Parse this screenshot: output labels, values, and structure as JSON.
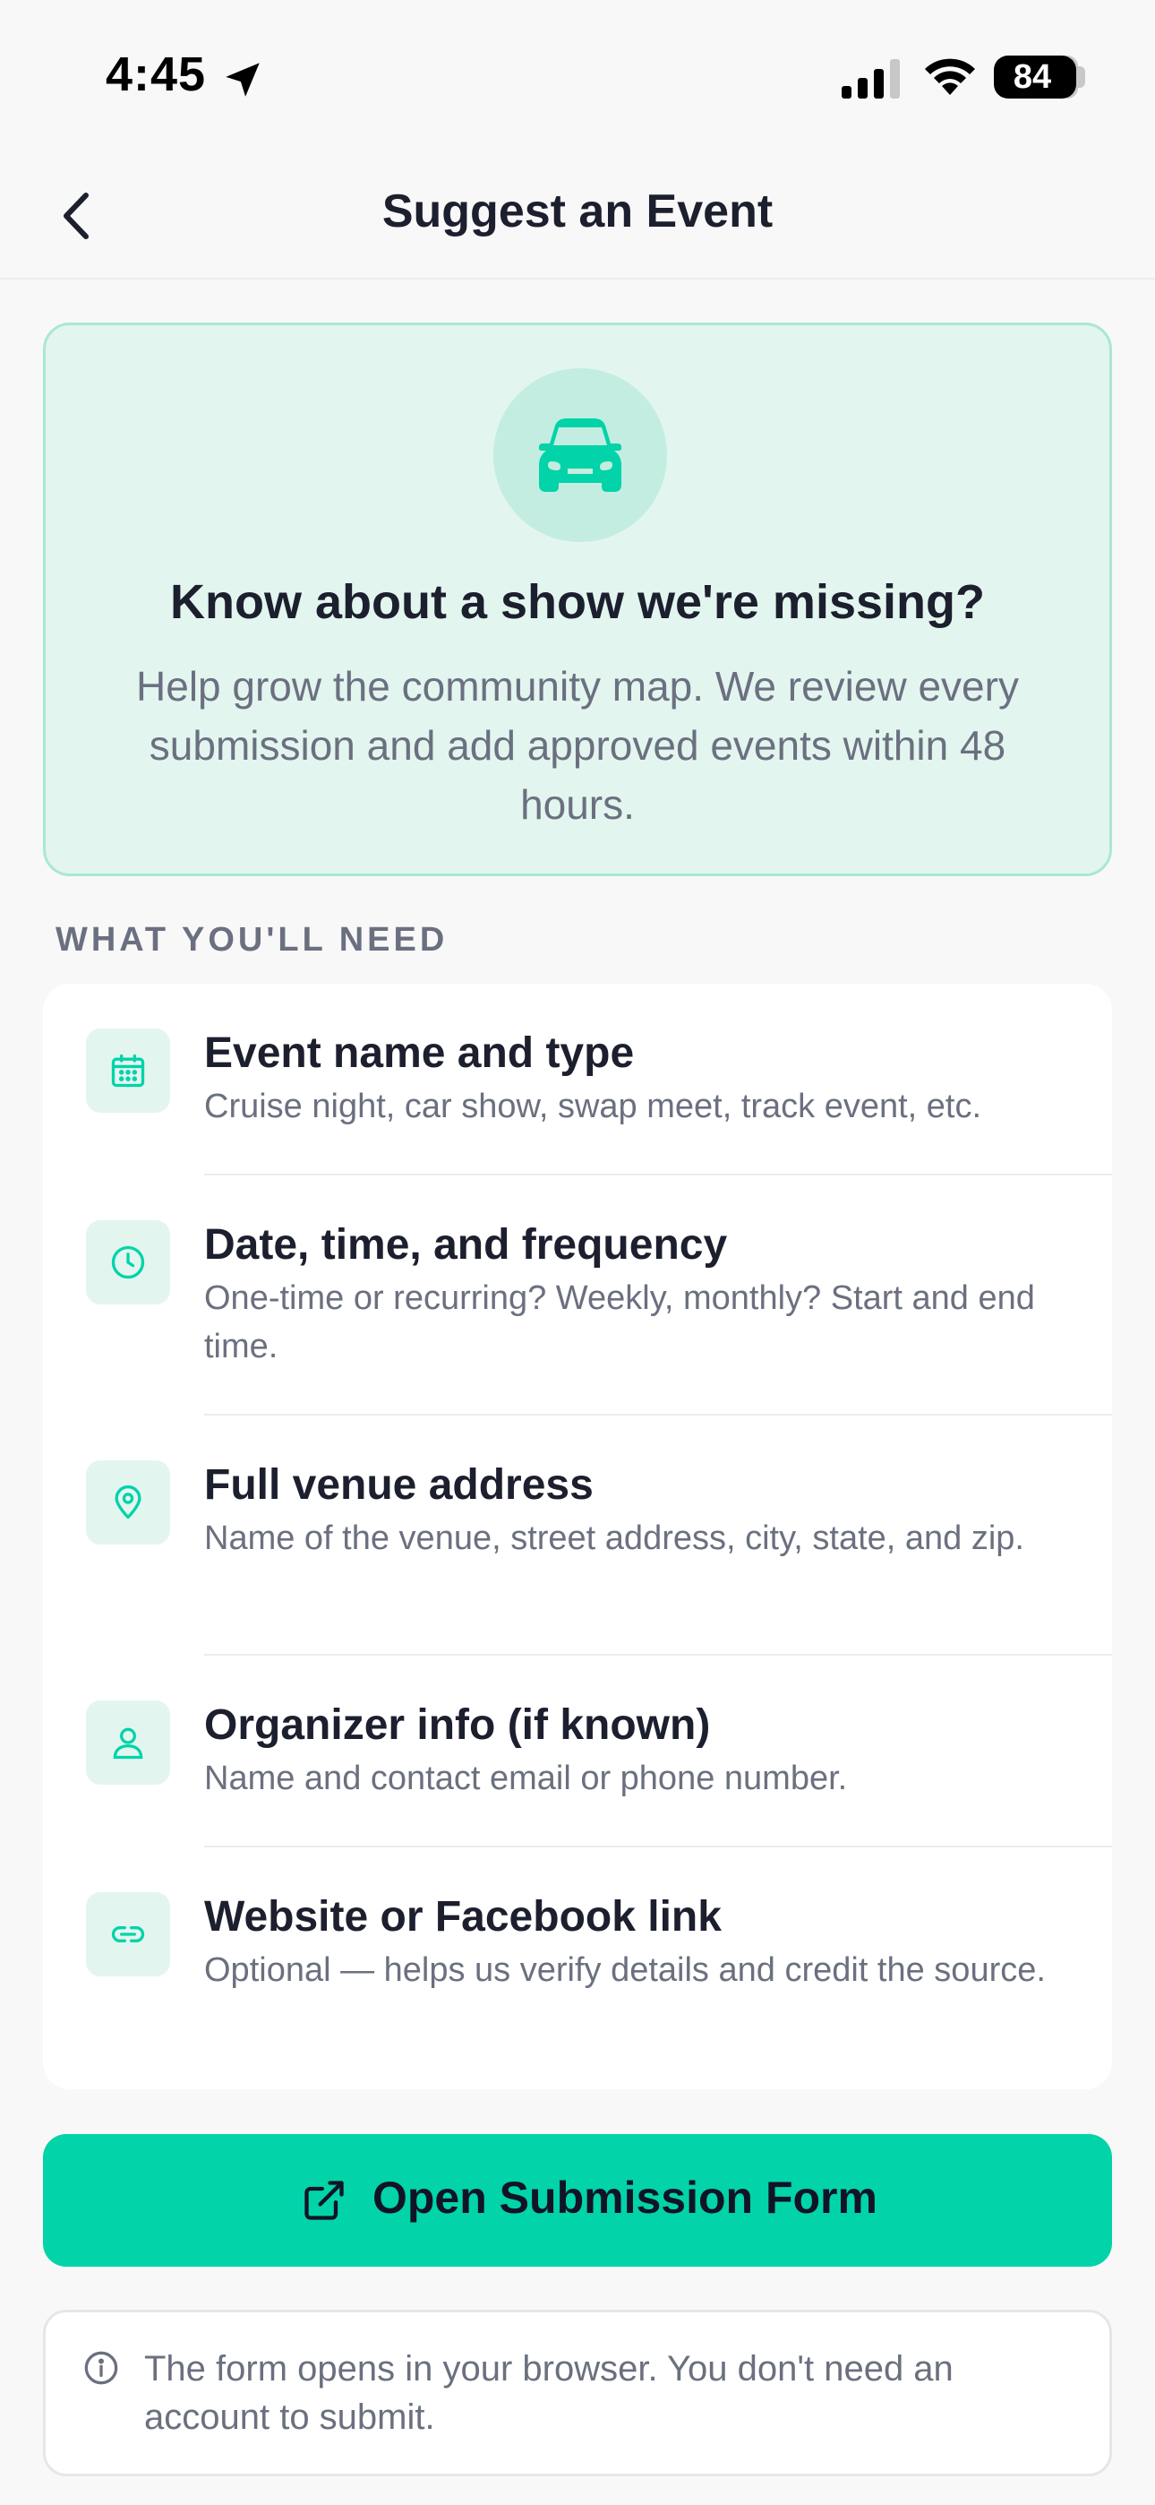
{
  "status_bar": {
    "time": "4:45",
    "battery": "84"
  },
  "nav": {
    "title": "Suggest an Event"
  },
  "hero": {
    "icon": "car-icon",
    "title": "Know about a show we're missing?",
    "text": "Help grow the community map. We review every submission and add approved events within 48 hours."
  },
  "section": {
    "header": "WHAT YOU'LL NEED"
  },
  "items": [
    {
      "icon": "calendar-icon",
      "title": "Event name and type",
      "desc": "Cruise night, car show, swap meet, track event, etc."
    },
    {
      "icon": "clock-icon",
      "title": "Date, time, and frequency",
      "desc": "One-time or recurring? Weekly, monthly? Start and end time."
    },
    {
      "icon": "location-pin-icon",
      "title": "Full venue address",
      "desc": "Name of the venue, street address, city, state, and zip."
    },
    {
      "icon": "person-icon",
      "title": "Organizer info (if known)",
      "desc": "Name and contact email or phone number."
    },
    {
      "icon": "link-icon",
      "title": "Website or Facebook link",
      "desc": "Optional — helps us verify details and credit the source."
    }
  ],
  "button": {
    "label": "Open Submission Form",
    "icon": "external-link-icon"
  },
  "note": {
    "icon": "info-icon",
    "text": "The form opens in your browser. You don't need an account to submit."
  },
  "colors": {
    "accent": "#02d3a9",
    "hero_bg": "#e3f5ef",
    "text": "#1c1f2e",
    "muted": "#6b7080"
  }
}
